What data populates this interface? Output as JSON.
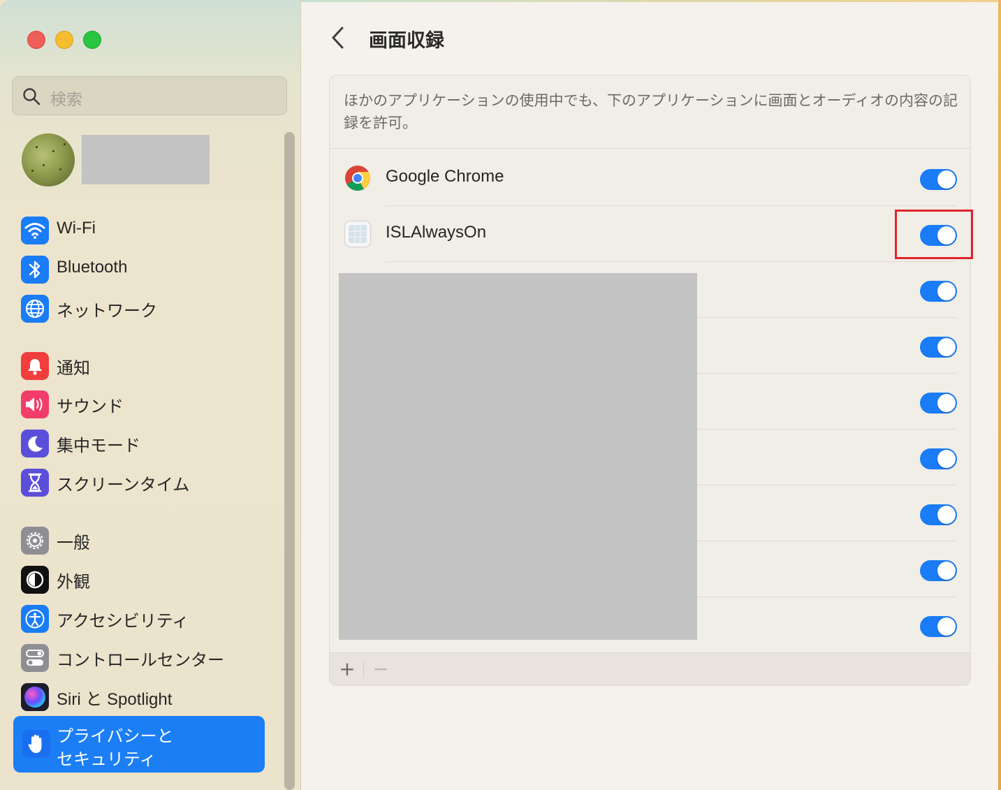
{
  "window": {
    "traffic_lights": [
      "close",
      "minimize",
      "zoom"
    ]
  },
  "sidebar": {
    "search_placeholder": "検索",
    "items": [
      {
        "label": "Wi-Fi",
        "icon": "wifi-icon",
        "color": "#1a7cf6"
      },
      {
        "label": "Bluetooth",
        "icon": "bluetooth-icon",
        "color": "#1a7cf6"
      },
      {
        "label": "ネットワーク",
        "icon": "globe-icon",
        "color": "#1a7cf6"
      },
      {
        "label": "通知",
        "icon": "bell-icon",
        "color": "#f23d3d"
      },
      {
        "label": "サウンド",
        "icon": "speaker-icon",
        "color": "#f23d6a"
      },
      {
        "label": "集中モード",
        "icon": "moon-icon",
        "color": "#5b4fd9"
      },
      {
        "label": "スクリーンタイム",
        "icon": "hourglass-icon",
        "color": "#5b4fd9"
      },
      {
        "label": "一般",
        "icon": "gear-icon",
        "color": "#8e8e93"
      },
      {
        "label": "外観",
        "icon": "appearance-icon",
        "color": "#111111"
      },
      {
        "label": "アクセシビリティ",
        "icon": "accessibility-icon",
        "color": "#1a7cf6"
      },
      {
        "label": "コントロールセンター",
        "icon": "switches-icon",
        "color": "#8e8e93"
      },
      {
        "label": "Siri と Spotlight",
        "icon": "siri-icon",
        "color": "#2a2a3a"
      }
    ],
    "selected": {
      "label_line1": "プライバシーと",
      "label_line2": "セキュリティ",
      "icon": "hand-icon",
      "color": "#1b7ef5"
    }
  },
  "main": {
    "title": "画面収録",
    "description": "ほかのアプリケーションの使用中でも、下のアプリケーションに画面とオーディオの内容の記録を許可。",
    "apps": [
      {
        "name": "Google Chrome",
        "enabled": true
      },
      {
        "name": "ISLAlwaysOn",
        "enabled": true
      }
    ],
    "redacted_app_toggles": [
      true,
      true,
      true,
      true,
      true,
      true,
      true
    ],
    "footer": {
      "add_label": "+",
      "remove_label": "−"
    },
    "accent_color": "#1a7cf6",
    "highlight_color": "#e2242b"
  }
}
